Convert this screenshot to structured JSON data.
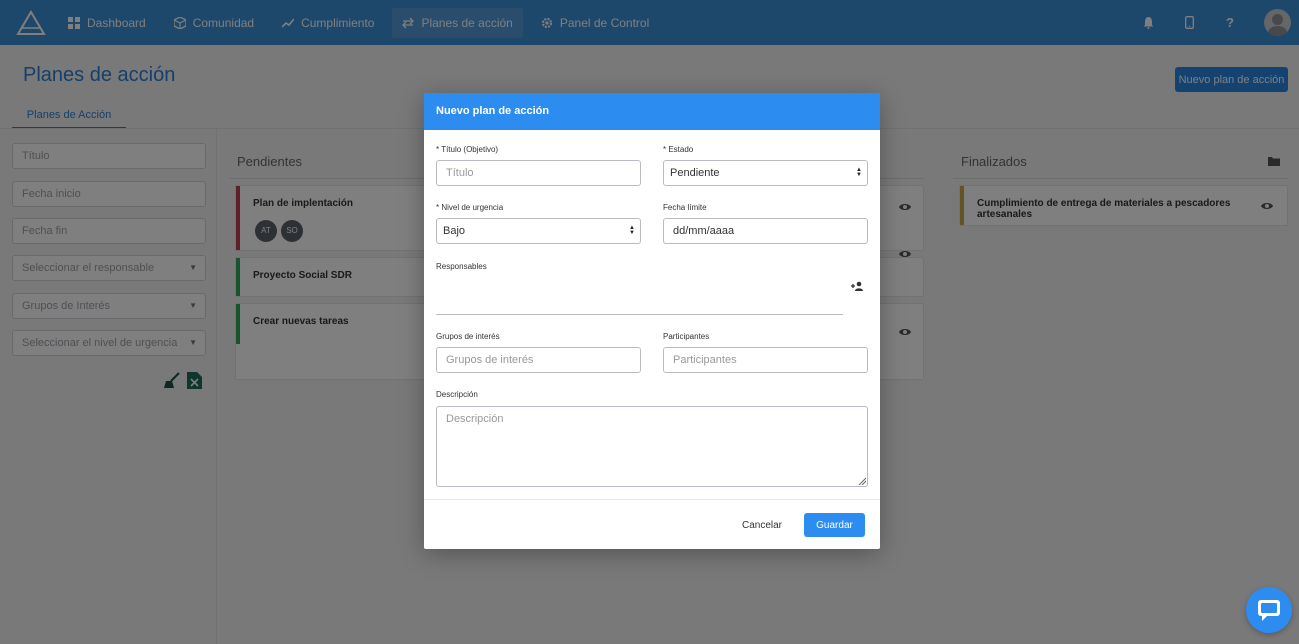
{
  "nav": {
    "items": [
      {
        "label": "Dashboard",
        "icon": "grid-icon"
      },
      {
        "label": "Comunidad",
        "icon": "cube-icon"
      },
      {
        "label": "Cumplimiento",
        "icon": "trend-icon"
      },
      {
        "label": "Planes de acción",
        "icon": "exchange-icon"
      },
      {
        "label": "Panel de Control",
        "icon": "gear-icon"
      }
    ],
    "active_index": 3,
    "right_icons": [
      "bell-icon",
      "mobile-icon",
      "help-icon",
      "avatar"
    ]
  },
  "page": {
    "title": "Planes de acción",
    "new_plan_label": "Nuevo plan de acción",
    "tab_label": "Planes de Acción"
  },
  "filters": {
    "titulo": "Título",
    "fecha_inicio": "Fecha inicio",
    "fecha_fin": "Fecha fin",
    "responsable": "Seleccionar el responsable",
    "grupos": "Grupos de Interés",
    "urgencia": "Seleccionar el nivel de urgencia",
    "actions": [
      "clear-icon",
      "excel-icon"
    ]
  },
  "columns": {
    "pendientes": {
      "title": "Pendientes",
      "cards": [
        {
          "title": "Plan de implentación",
          "color": "#c23b52",
          "chips": [
            "AT",
            "SO"
          ]
        },
        {
          "title": "Proyecto Social SDR",
          "color": "#2eaa5c"
        },
        {
          "title": "Crear nuevas tareas",
          "color": "#2eaa5c"
        }
      ]
    },
    "finalizados": {
      "title": "Finalizados",
      "cards": [
        {
          "title": "Cumplimiento de entrega de materiales a pescadores artesanales",
          "color": "#c9a94a"
        }
      ]
    }
  },
  "modal": {
    "title": "Nuevo plan de acción",
    "titulo_label": "* Título (Objetivo)",
    "titulo_placeholder": "Título",
    "estado_label": "* Estado",
    "estado_value": "Pendiente",
    "urgencia_label": "* Nivel de urgencia",
    "urgencia_value": "Bajo",
    "fecha_label": "Fecha límite",
    "fecha_placeholder": "dd/mm/aaaa",
    "responsables_label": "Responsables",
    "grupos_label": "Grupos de interés",
    "grupos_placeholder": "Grupos de interés",
    "participantes_label": "Participantes",
    "participantes_placeholder": "Participantes",
    "descripcion_label": "Descripción",
    "descripcion_placeholder": "Descripción",
    "cancel_label": "Cancelar",
    "save_label": "Guardar"
  },
  "colors": {
    "primary": "#2d8cf0",
    "nav_bg": "#3d8ed8"
  }
}
